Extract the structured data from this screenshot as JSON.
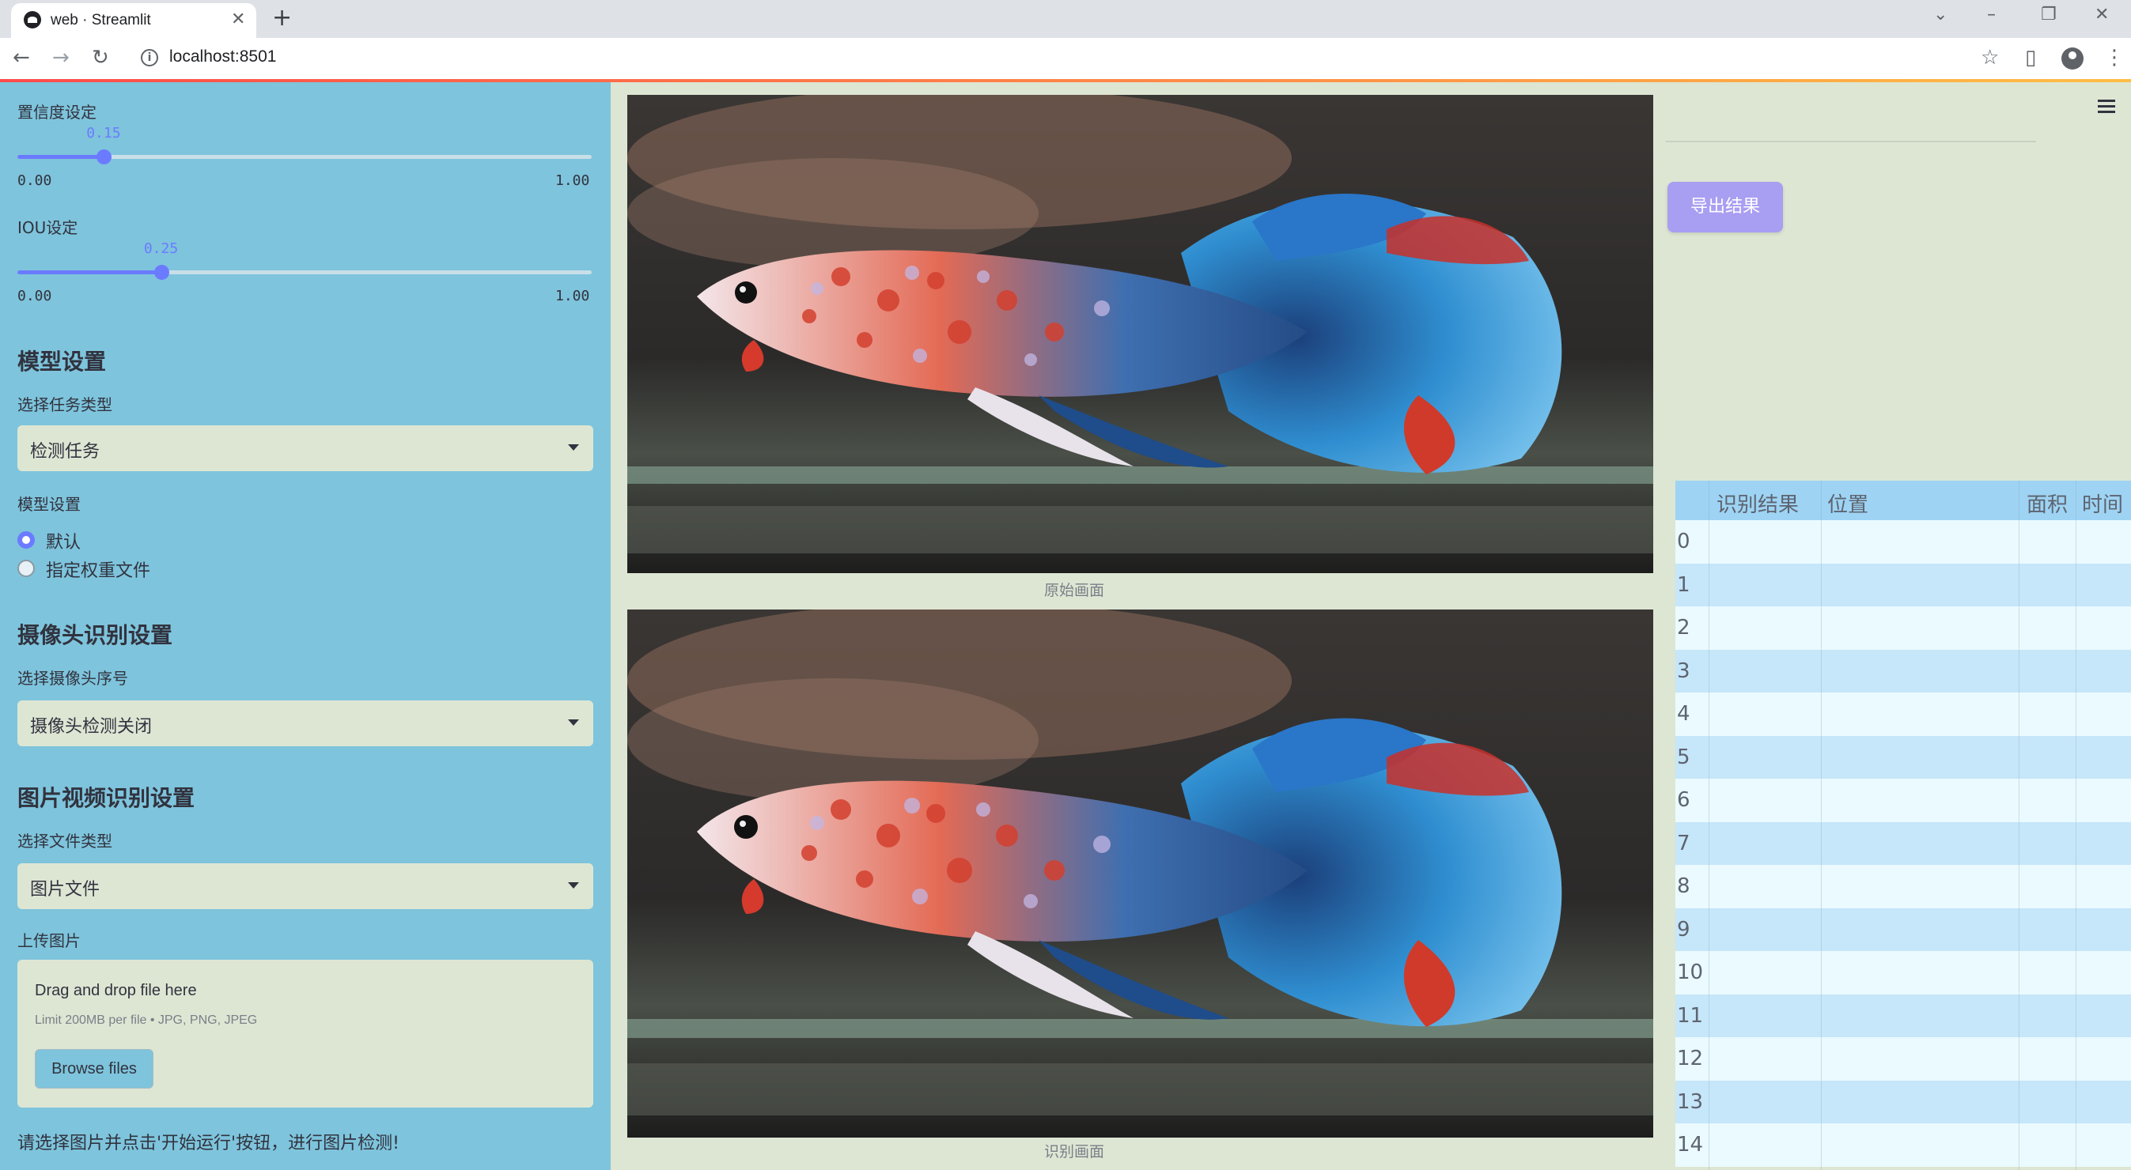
{
  "browser": {
    "tab_title": "web · Streamlit",
    "url": "localhost:8501",
    "icons": [
      "back-icon",
      "forward-icon",
      "reload-icon",
      "info-icon",
      "bookmark-star-icon",
      "side-panel-icon",
      "profile-icon",
      "menu-dots-icon"
    ]
  },
  "sidebar": {
    "confidence": {
      "label": "置信度设定",
      "value": "0.15",
      "value_num": 0.15,
      "min": "0.00",
      "max": "1.00"
    },
    "iou": {
      "label": "IOU设定",
      "value": "0.25",
      "value_num": 0.25,
      "min": "0.00",
      "max": "1.00"
    },
    "model_heading": "模型设置",
    "task_type_label": "选择任务类型",
    "task_type_value": "检测任务",
    "model_settings_label": "模型设置",
    "model_options": [
      "默认",
      "指定权重文件"
    ],
    "model_selected": "默认",
    "camera_heading": "摄像头识别设置",
    "camera_label": "选择摄像头序号",
    "camera_value": "摄像头检测关闭",
    "media_heading": "图片视频识别设置",
    "file_type_label": "选择文件类型",
    "file_type_value": "图片文件",
    "upload_label": "上传图片",
    "uploader": {
      "title": "Drag and drop file here",
      "limit": "Limit 200MB per file • JPG, PNG, JPEG",
      "button": "Browse files"
    },
    "hint": "请选择图片并点击'开始运行'按钮，进行图片检测!"
  },
  "main": {
    "original_caption": "原始画面",
    "result_caption": "识别画面"
  },
  "right_panel": {
    "export_button": "导出结果",
    "table": {
      "columns": [
        "识别结果",
        "位置",
        "面积",
        "时间"
      ],
      "row_indices": [
        "0",
        "1",
        "2",
        "3",
        "4",
        "5",
        "6",
        "7",
        "8",
        "9",
        "10",
        "11",
        "12",
        "13",
        "14"
      ]
    }
  },
  "colors": {
    "sidebar_bg": "#7ec4dc",
    "main_bg": "#dde6d3",
    "accent": "#6b7bff",
    "export_button": "#a89ef2",
    "table_header": "#9ed3f3"
  }
}
